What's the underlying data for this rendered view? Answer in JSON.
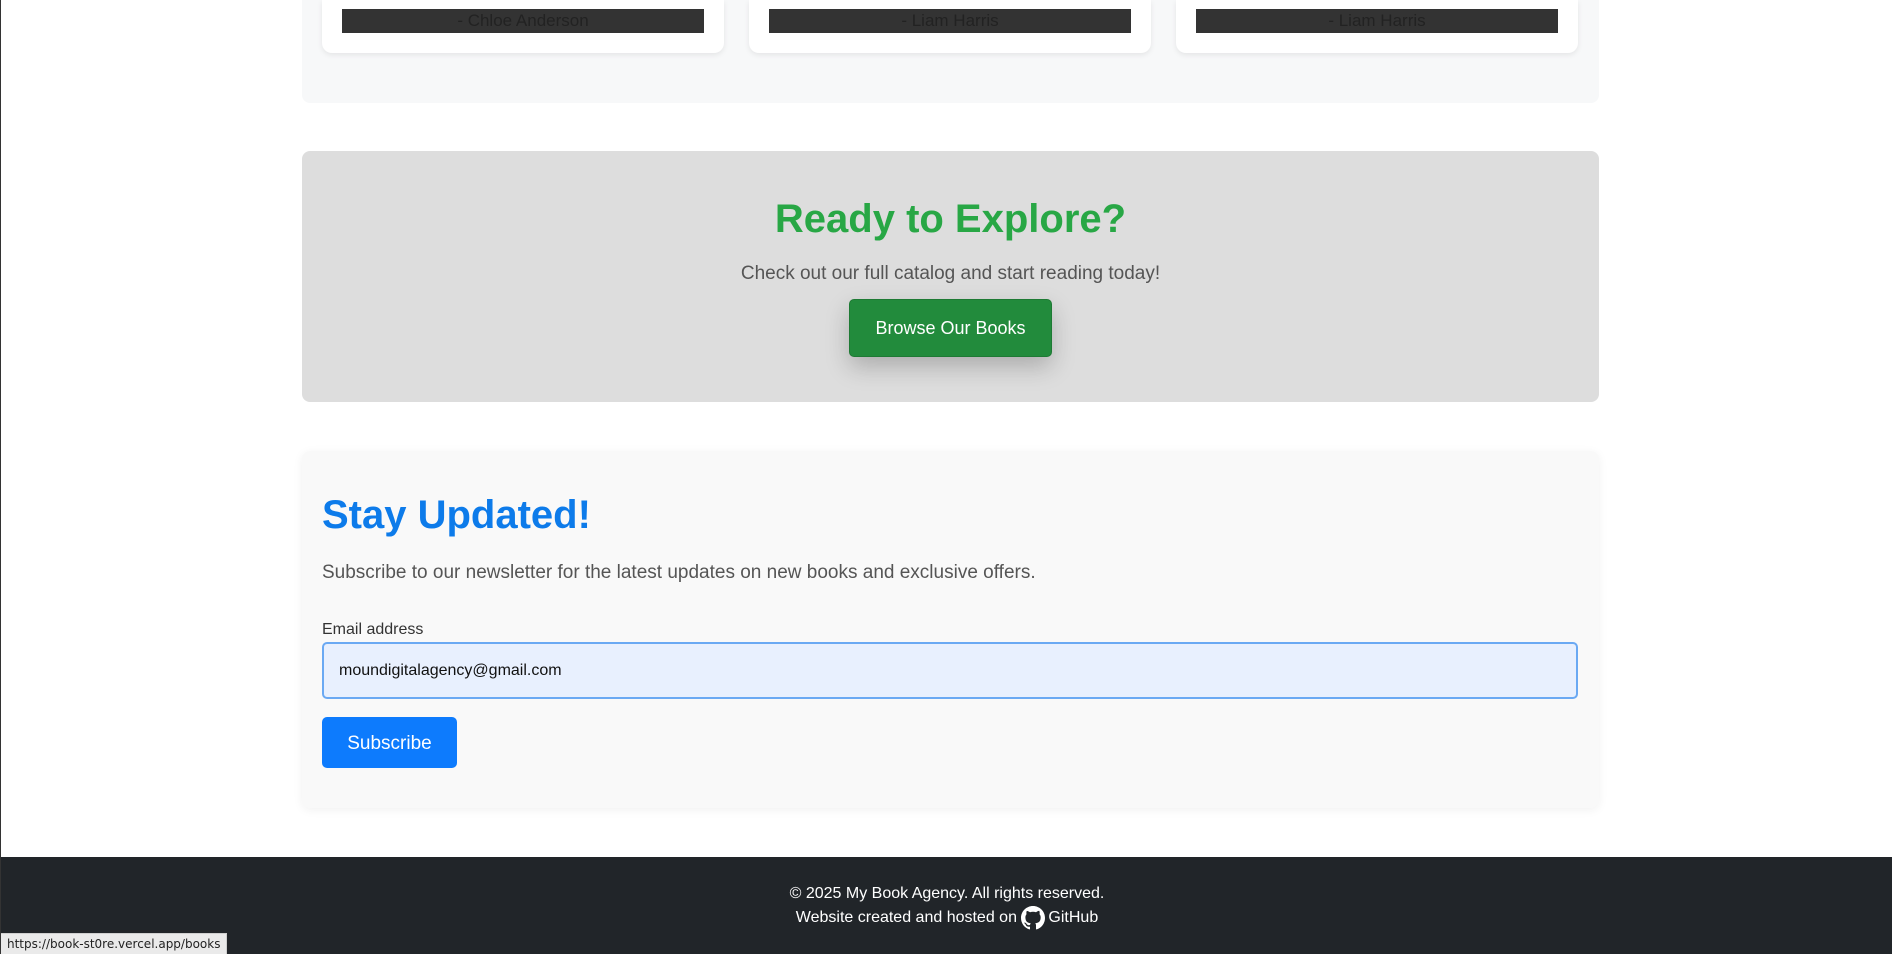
{
  "testimonials": {
    "cards": [
      {
        "author": "- Chloe Anderson"
      },
      {
        "author": "- Liam Harris"
      },
      {
        "author": "- Liam Harris"
      }
    ]
  },
  "cta": {
    "title": "Ready to Explore?",
    "subtitle": "Check out our full catalog and start reading today!",
    "button_label": "Browse Our Books"
  },
  "newsletter": {
    "title": "Stay Updated!",
    "description": "Subscribe to our newsletter for the latest updates on new books and exclusive offers.",
    "email_label": "Email address",
    "email_value": "moundigitalagency@gmail.com",
    "subscribe_label": "Subscribe"
  },
  "footer": {
    "copyright": "© 2025 My Book Agency. All rights reserved.",
    "credit_prefix": "Website created and hosted on",
    "github_label": "GitHub",
    "github_icon": "github-icon"
  },
  "status_bar": {
    "url": "https://book-st0re.vercel.app/books"
  },
  "colors": {
    "cta_title": "#28a745",
    "cta_button": "#228b3c",
    "newsletter_title": "#0d7bea",
    "subscribe_button": "#0d7bfd",
    "footer_bg": "#212529",
    "cta_bg": "#dddddd"
  }
}
